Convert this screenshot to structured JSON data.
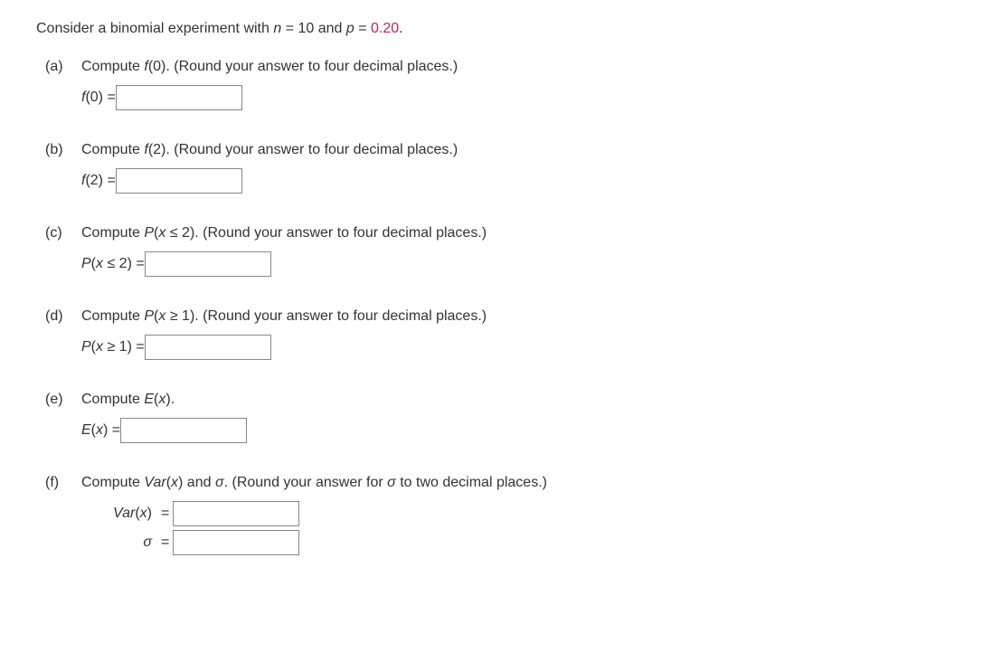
{
  "intro": {
    "prefix": "Consider a binomial experiment with ",
    "n_var": "n",
    "n_eq": " = 10 and ",
    "p_var": "p",
    "p_eq": " = ",
    "p_val": "0.20",
    "suffix": "."
  },
  "parts": {
    "a": {
      "label": "(a)",
      "instruction_prefix": "Compute ",
      "instruction_func": "f",
      "instruction_arg": "(0). ",
      "instruction_suffix": "(Round your answer to four decimal places.)",
      "answer_func": "f",
      "answer_arg": "(0)",
      "eq": " = "
    },
    "b": {
      "label": "(b)",
      "instruction_prefix": "Compute ",
      "instruction_func": "f",
      "instruction_arg": "(2). ",
      "instruction_suffix": "(Round your answer to four decimal places.)",
      "answer_func": "f",
      "answer_arg": "(2)",
      "eq": " = "
    },
    "c": {
      "label": "(c)",
      "instruction_prefix": "Compute ",
      "instruction_func": "P",
      "instruction_arg_open": "(",
      "instruction_var": "x",
      "instruction_rel": " ≤ 2). ",
      "instruction_suffix": "(Round your answer to four decimal places.)",
      "answer_func": "P",
      "answer_arg_open": "(",
      "answer_var": "x",
      "answer_rel": " ≤ 2)",
      "eq": " = "
    },
    "d": {
      "label": "(d)",
      "instruction_prefix": "Compute ",
      "instruction_func": "P",
      "instruction_arg_open": "(",
      "instruction_var": "x",
      "instruction_rel": " ≥ 1). ",
      "instruction_suffix": "(Round your answer to four decimal places.)",
      "answer_func": "P",
      "answer_arg_open": "(",
      "answer_var": "x",
      "answer_rel": " ≥ 1)",
      "eq": " = "
    },
    "e": {
      "label": "(e)",
      "instruction_prefix": "Compute ",
      "instruction_func": "E",
      "instruction_arg_open": "(",
      "instruction_var": "x",
      "instruction_rel": ").",
      "answer_func": "E",
      "answer_arg_open": "(",
      "answer_var": "x",
      "answer_rel": ")",
      "eq": " = "
    },
    "f": {
      "label": "(f)",
      "instruction_prefix": "Compute ",
      "instruction_func": "Var",
      "instruction_arg_open": "(",
      "instruction_var": "x",
      "instruction_rel": ") and ",
      "instruction_sigma": "σ",
      "instruction_mid": ". (Round your answer for ",
      "instruction_sigma2": "σ",
      "instruction_suffix": " to two decimal places.)",
      "answer1_func": "Var",
      "answer1_arg_open": "(",
      "answer1_var": "x",
      "answer1_rel": ")",
      "answer2_sigma": "σ",
      "eq": "="
    }
  }
}
